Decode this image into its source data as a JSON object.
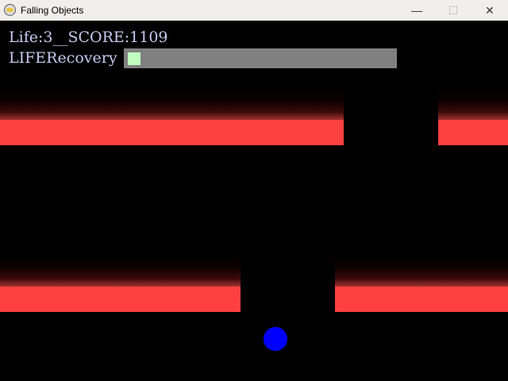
{
  "window": {
    "title": "Falling Objects",
    "icon": "app-icon",
    "buttons": {
      "minimize": "—",
      "maximize": "☐",
      "close": "✕"
    }
  },
  "hud": {
    "status_line": "Life:3__SCORE:1109",
    "life": 3,
    "score": 1109,
    "recovery_label": "LIFERecovery",
    "recovery_progress": 0.05
  },
  "colors": {
    "platform": "#ff4040",
    "ball": "#0000ff",
    "recovery_fill": "#c0ffc0",
    "recovery_track": "#808080"
  }
}
